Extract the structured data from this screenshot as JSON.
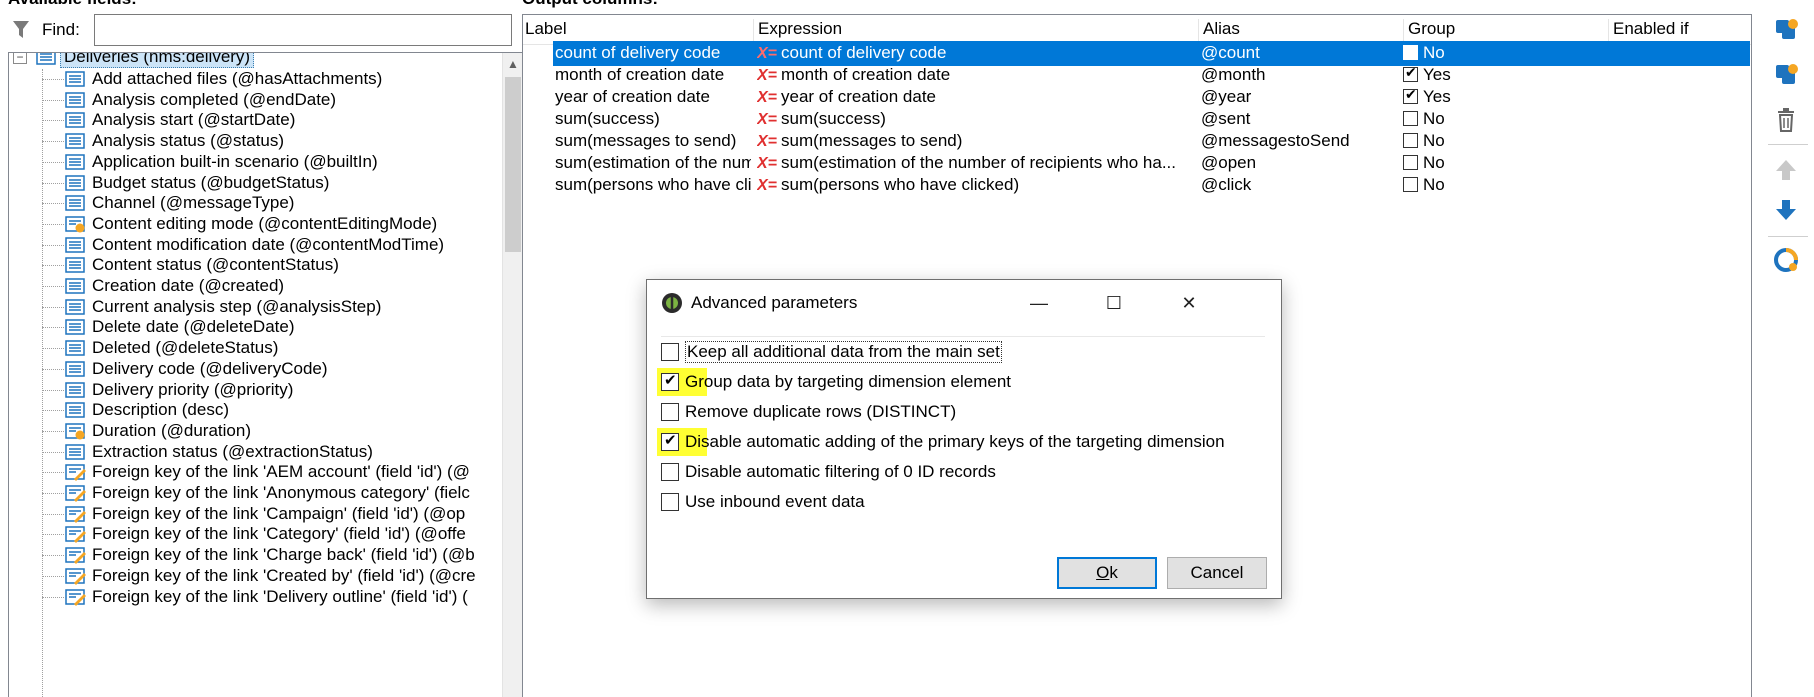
{
  "left_panel": {
    "title": "Available fields:",
    "find_label": "Find:",
    "find_value": "",
    "root": {
      "label": "Deliveries (nms:delivery)",
      "expander": "−"
    },
    "fields": [
      {
        "label": "Add attached files (@hasAttachments)",
        "icon": "attribute-icon"
      },
      {
        "label": "Analysis completed (@endDate)",
        "icon": "attribute-icon"
      },
      {
        "label": "Analysis start (@startDate)",
        "icon": "attribute-icon"
      },
      {
        "label": "Analysis status (@status)",
        "icon": "attribute-icon"
      },
      {
        "label": "Application built-in scenario (@builtIn)",
        "icon": "attribute-icon"
      },
      {
        "label": "Budget status (@budgetStatus)",
        "icon": "attribute-icon"
      },
      {
        "label": "Channel (@messageType)",
        "icon": "attribute-icon"
      },
      {
        "label": "Content editing mode (@contentEditingMode)",
        "icon": "computed-attribute-icon"
      },
      {
        "label": "Content modification date (@contentModTime)",
        "icon": "attribute-icon"
      },
      {
        "label": "Content status (@contentStatus)",
        "icon": "attribute-icon"
      },
      {
        "label": "Creation date (@created)",
        "icon": "attribute-icon"
      },
      {
        "label": "Current analysis step (@analysisStep)",
        "icon": "attribute-icon"
      },
      {
        "label": "Delete date (@deleteDate)",
        "icon": "attribute-icon"
      },
      {
        "label": "Deleted (@deleteStatus)",
        "icon": "attribute-icon"
      },
      {
        "label": "Delivery code (@deliveryCode)",
        "icon": "attribute-icon"
      },
      {
        "label": "Delivery priority (@priority)",
        "icon": "attribute-icon"
      },
      {
        "label": "Description (desc)",
        "icon": "attribute-icon"
      },
      {
        "label": "Duration (@duration)",
        "icon": "computed-attribute-icon"
      },
      {
        "label": "Extraction status (@extractionStatus)",
        "icon": "attribute-icon"
      },
      {
        "label": "Foreign key of the link 'AEM account' (field 'id') (@",
        "icon": "foreign-key-icon"
      },
      {
        "label": "Foreign key of the link 'Anonymous category' (fielc",
        "icon": "foreign-key-icon"
      },
      {
        "label": "Foreign key of the link 'Campaign' (field 'id') (@op",
        "icon": "foreign-key-icon"
      },
      {
        "label": "Foreign key of the link 'Category' (field 'id') (@offe",
        "icon": "foreign-key-icon"
      },
      {
        "label": "Foreign key of the link 'Charge back' (field 'id') (@b",
        "icon": "foreign-key-icon"
      },
      {
        "label": "Foreign key of the link 'Created by' (field 'id') (@cre",
        "icon": "foreign-key-icon"
      },
      {
        "label": "Foreign key of the link 'Delivery outline' (field 'id') (",
        "icon": "foreign-key-icon"
      }
    ]
  },
  "right_panel": {
    "title": "Output columns:",
    "headers": {
      "label": "Label",
      "expression": "Expression",
      "alias": "Alias",
      "group": "Group",
      "enabled_if": "Enabled if"
    },
    "expr_icon": "X=",
    "rows": [
      {
        "label": "count of delivery code",
        "expression": "count of delivery code",
        "alias": "@count",
        "group_checked": false,
        "group": "No",
        "selected": true
      },
      {
        "label": "month of creation date",
        "expression": "month of creation date",
        "alias": "@month",
        "group_checked": true,
        "group": "Yes",
        "selected": false
      },
      {
        "label": "year of creation date",
        "expression": "year of creation date",
        "alias": "@year",
        "group_checked": true,
        "group": "Yes",
        "selected": false
      },
      {
        "label": "sum(success)",
        "expression": "sum(success)",
        "alias": "@sent",
        "group_checked": false,
        "group": "No",
        "selected": false
      },
      {
        "label": "sum(messages to send)",
        "expression": "sum(messages to send)",
        "alias": "@messagestoSend",
        "group_checked": false,
        "group": "No",
        "selected": false
      },
      {
        "label": "sum(estimation of the num...",
        "expression": "sum(estimation of the number of recipients who ha...",
        "alias": "@open",
        "group_checked": false,
        "group": "No",
        "selected": false
      },
      {
        "label": "sum(persons who have click...",
        "expression": "sum(persons who have clicked)",
        "alias": "@click",
        "group_checked": false,
        "group": "No",
        "selected": false
      }
    ]
  },
  "toolbar": {
    "buttons": [
      "add-icon",
      "edit-icon",
      "trash-icon",
      "move-up-icon",
      "move-down-icon",
      "distribution-icon"
    ]
  },
  "dialog": {
    "title": "Advanced parameters",
    "minimize": "—",
    "maximize": "☐",
    "close": "✕",
    "options": [
      {
        "label": "Keep all additional data from the main set",
        "checked": false,
        "highlighted": false
      },
      {
        "label": "Group data by targeting dimension element",
        "checked": true,
        "highlighted": true
      },
      {
        "label": "Remove duplicate rows (DISTINCT)",
        "checked": false,
        "highlighted": false
      },
      {
        "label": "Disable automatic adding of the primary keys of the targeting dimension",
        "checked": true,
        "highlighted": true
      },
      {
        "label": "Disable automatic filtering of 0 ID records",
        "checked": false,
        "highlighted": false
      },
      {
        "label": "Use inbound event data",
        "checked": false,
        "highlighted": false
      }
    ],
    "ok_label": "Ok",
    "cancel_label": "Cancel"
  },
  "colors": {
    "selection": "#0078d7",
    "highlight": "#ffff33",
    "expression_icon": "#e03030",
    "icon_blue": "#1e73be",
    "icon_orange": "#f5a623"
  }
}
